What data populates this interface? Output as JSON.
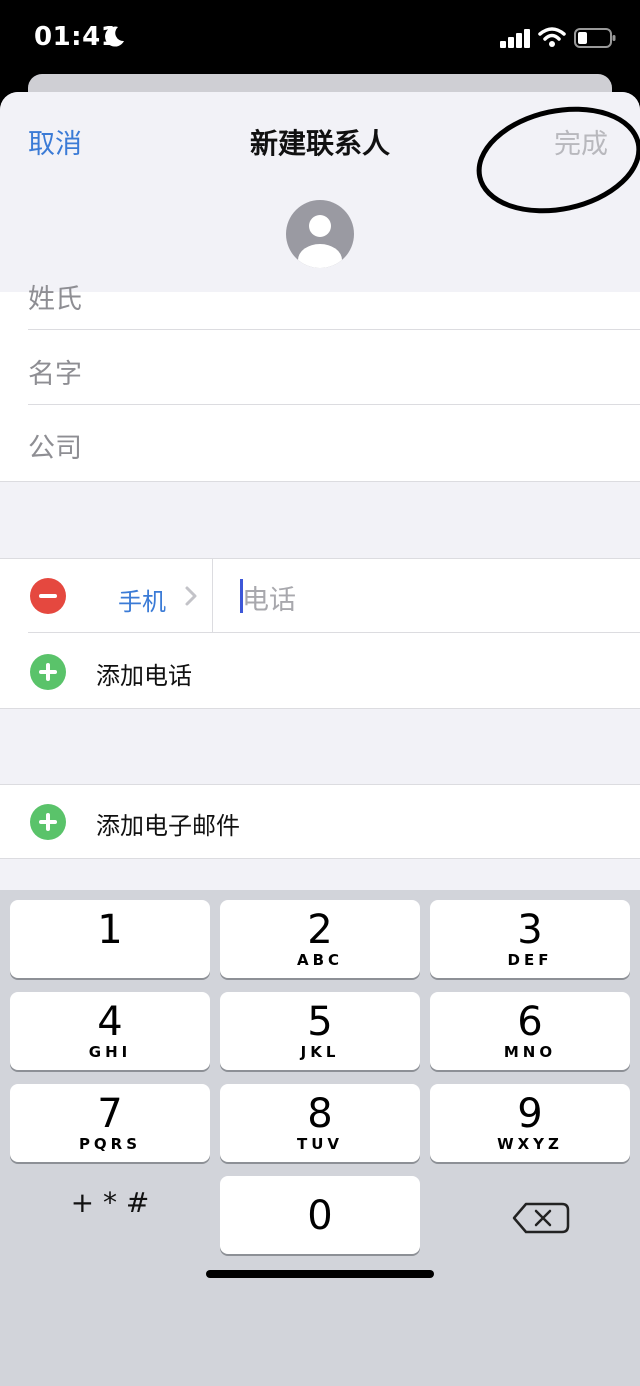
{
  "status_bar": {
    "time": "01:41"
  },
  "nav": {
    "cancel_label": "取消",
    "title": "新建联系人",
    "done_label": "完成"
  },
  "fields": {
    "last_name_placeholder": "姓氏",
    "first_name_placeholder": "名字",
    "company_placeholder": "公司"
  },
  "phone": {
    "label_type": "手机",
    "placeholder": "电话",
    "add_label": "添加电话"
  },
  "email": {
    "add_label": "添加电子邮件"
  },
  "keypad": {
    "keys": [
      {
        "num": "1",
        "letters": ""
      },
      {
        "num": "2",
        "letters": "ABC"
      },
      {
        "num": "3",
        "letters": "DEF"
      },
      {
        "num": "4",
        "letters": "GHI"
      },
      {
        "num": "5",
        "letters": "JKL"
      },
      {
        "num": "6",
        "letters": "MNO"
      },
      {
        "num": "7",
        "letters": "PQRS"
      },
      {
        "num": "8",
        "letters": "TUV"
      },
      {
        "num": "9",
        "letters": "WXYZ"
      }
    ],
    "symbols_label": "+ * #",
    "zero": "0"
  },
  "colors": {
    "accent": "#3b7bd6",
    "destructive": "#e5483f",
    "add": "#5ac36a",
    "annotation": "#000000"
  }
}
